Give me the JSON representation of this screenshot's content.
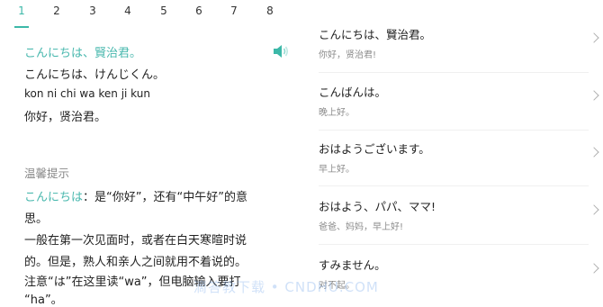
{
  "tabs": [
    "1",
    "2",
    "3",
    "4",
    "5",
    "6",
    "7",
    "8"
  ],
  "lesson": {
    "title_jp": "こんにちは、賢治君。",
    "kana": "こんにちは、けんじくん。",
    "romaji": "kon ni chi wa ken ji kun",
    "translation": "你好，贤治君。"
  },
  "tips": {
    "heading": "温馨提示",
    "line1_highlight": "こんにちは",
    "line1_rest": "：是“你好”，还有“中午好”的意",
    "line2": "思。",
    "line3": "一般在第一次见面时，或者在白天寒暄时说",
    "line4": "的。但是，熟人和亲人之间就用不着说的。",
    "line5": "注意“は”在这里读“wa”，但电脑输入要打",
    "line6": "“ha”。"
  },
  "phrases": [
    {
      "jp": "こんにちは、賢治君。",
      "cn": "你好，贤治君!"
    },
    {
      "jp": "こんばんは。",
      "cn": "晚上好。"
    },
    {
      "jp": "おはようございます。",
      "cn": "早上好。"
    },
    {
      "jp": "おはよう、パパ、ママ!",
      "cn": "爸爸、妈妈，早上好!"
    },
    {
      "jp": "すみません。",
      "cn": "对不起。"
    }
  ],
  "watermark": "滴答教下载 • CNDHU.COM",
  "colors": {
    "accent": "#3cb8a8",
    "text": "#222222",
    "muted": "#888888"
  }
}
